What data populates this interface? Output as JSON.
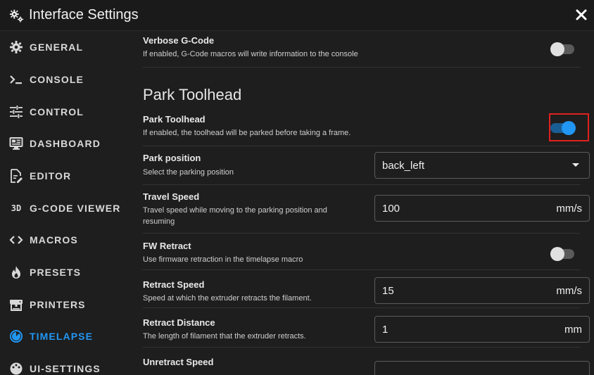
{
  "dialog": {
    "title": "Interface Settings"
  },
  "sidebar": {
    "items": [
      {
        "label": "GENERAL",
        "icon": "gear-icon"
      },
      {
        "label": "CONSOLE",
        "icon": "console-icon"
      },
      {
        "label": "CONTROL",
        "icon": "tune-icon"
      },
      {
        "label": "DASHBOARD",
        "icon": "monitor-dashboard-icon"
      },
      {
        "label": "EDITOR",
        "icon": "file-edit-icon"
      },
      {
        "label": "G-CODE VIEWER",
        "icon": "3d-icon",
        "icon_text": "3D"
      },
      {
        "label": "MACROS",
        "icon": "code-brackets-icon"
      },
      {
        "label": "PRESETS",
        "icon": "fire-icon"
      },
      {
        "label": "PRINTERS",
        "icon": "printer-3d-icon"
      },
      {
        "label": "TIMELAPSE",
        "icon": "timelapse-icon",
        "active": true
      },
      {
        "label": "UI-SETTINGS",
        "icon": "palette-icon"
      }
    ],
    "active_color": "#2196f3"
  },
  "content": {
    "verbose": {
      "name": "Verbose G-Code",
      "desc": "If enabled, G-Code macros will write information to the console",
      "enabled": false
    },
    "section_title": "Park Toolhead",
    "park_toolhead": {
      "name": "Park Toolhead",
      "desc": "If enabled, the toolhead will be parked before taking a frame.",
      "enabled": true
    },
    "park_position": {
      "name": "Park position",
      "desc": "Select the parking position",
      "value": "back_left"
    },
    "travel_speed": {
      "name": "Travel Speed",
      "desc_line1": "Travel speed while moving to the parking position and",
      "desc_line2": "resuming",
      "value": "100",
      "unit": "mm/s"
    },
    "fw_retract": {
      "name": "FW Retract",
      "desc": "Use firmware retraction in the timelapse macro",
      "enabled": false
    },
    "retract_speed": {
      "name": "Retract Speed",
      "desc": "Speed at which the extruder retracts the filament.",
      "value": "15",
      "unit": "mm/s"
    },
    "retract_distance": {
      "name": "Retract Distance",
      "desc": "The length of filament that the extruder retracts.",
      "value": "1",
      "unit": "mm"
    },
    "unretract_speed": {
      "name": "Unretract Speed"
    }
  },
  "colors": {
    "switch_on": "#2196f3",
    "highlight": "#e02020",
    "background": "#1e1e1e"
  }
}
